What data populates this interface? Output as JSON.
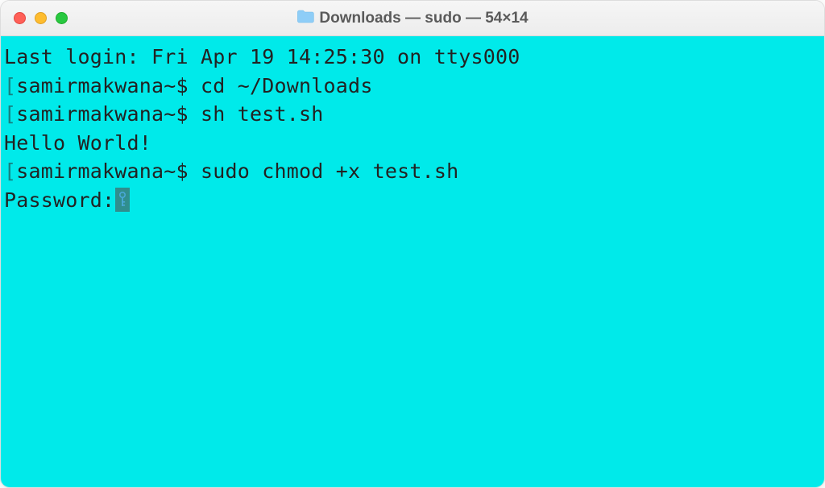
{
  "window": {
    "title": "Downloads — sudo — 54×14"
  },
  "terminal": {
    "last_login": "Last login: Fri Apr 19 14:25:30 on ttys000",
    "prompt": "samirmakwana~$ ",
    "cmd1": "cd ~/Downloads",
    "cmd2": "sh test.sh",
    "output1": "Hello World!",
    "cmd3": "sudo chmod +x test.sh",
    "password_label": "Password:"
  },
  "colors": {
    "background": "#00eaea",
    "text": "#222222"
  }
}
